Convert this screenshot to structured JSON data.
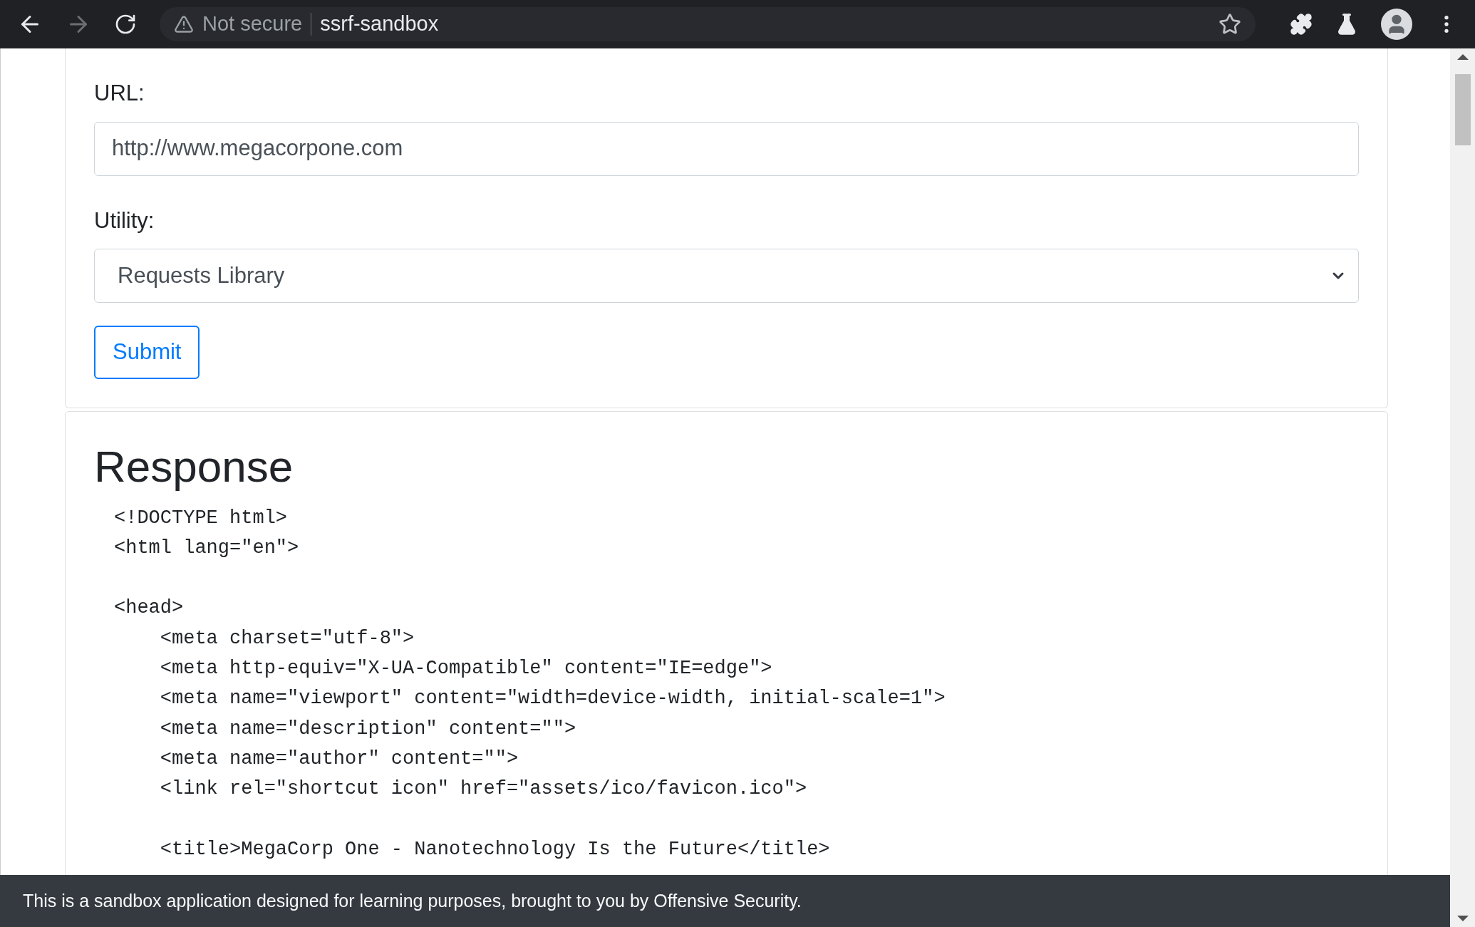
{
  "browser": {
    "security_label": "Not secure",
    "address": "ssrf-sandbox"
  },
  "form": {
    "url_label": "URL:",
    "url_value": "http://www.megacorpone.com",
    "utility_label": "Utility:",
    "utility_value": "Requests Library",
    "submit": "Submit"
  },
  "response": {
    "title": "Response",
    "body": "<!DOCTYPE html>\n<html lang=\"en\">\n\n<head>\n    <meta charset=\"utf-8\">\n    <meta http-equiv=\"X-UA-Compatible\" content=\"IE=edge\">\n    <meta name=\"viewport\" content=\"width=device-width, initial-scale=1\">\n    <meta name=\"description\" content=\"\">\n    <meta name=\"author\" content=\"\">\n    <link rel=\"shortcut icon\" href=\"assets/ico/favicon.ico\">\n\n    <title>MegaCorp One - Nanotechnology Is the Future</title>"
  },
  "footer": "This is a sandbox application designed for learning purposes, brought to you by Offensive Security."
}
